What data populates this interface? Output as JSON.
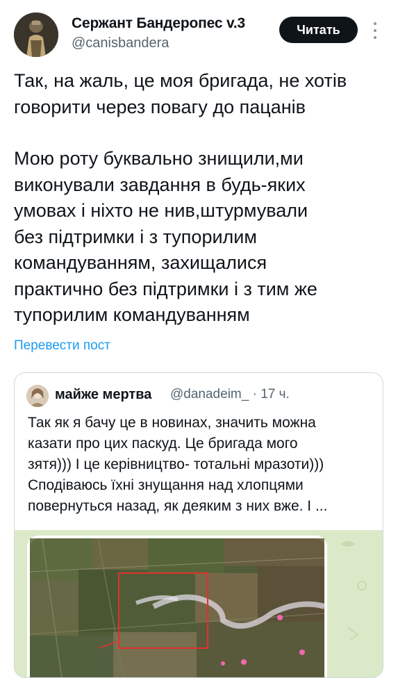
{
  "author": {
    "name": "Сержант Бандеропес v.3",
    "handle": "@canisbandera",
    "avatar_icon": "soldier-avatar"
  },
  "actions": {
    "read_label": "Читать",
    "more_icon": "more-vertical-icon"
  },
  "tweet": {
    "lines": [
      "Так, на жаль, це моя бригада, не хотів",
      "говорити через повагу до пацанів",
      "",
      "Мою роту буквально знищили,ми",
      "виконували завдання в будь-яких",
      "умовах і ніхто не нив,штурмували",
      "без підтримки і з тупорилим",
      "командуванням, захищалися",
      "практично без підтримки і з тим же",
      "тупорилим командуванням"
    ],
    "translate_label": "Перевести пост"
  },
  "quote": {
    "author_name": "майже мертва",
    "handle_time": "@danadeim_ · 17 ч.",
    "lines": [
      "Так як я бачу це в новинах, значить можна",
      "казати про цих паскуд. Це бригада мого",
      "зятя))) І це керівництво- тотальні мразоти)))",
      "Сподіваюсь їхні знущання над хлопцями",
      "повернуться назад, як деяким з них вже. І ..."
    ],
    "media": {
      "description_icon": "satellite-map-image",
      "accent_colors": {
        "highlight_box": "#e0322e",
        "front_line": "#e8e2f0",
        "markers": "#f06ab0"
      }
    }
  },
  "colors": {
    "text": "#0f1419",
    "secondary": "#536471",
    "link": "#1d9bf0",
    "button_bg": "#0f1419",
    "border": "#cfd9de"
  }
}
